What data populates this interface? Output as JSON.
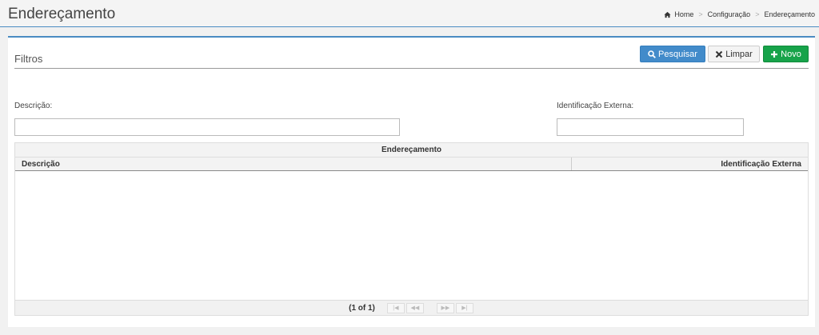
{
  "header": {
    "title": "Endereçamento",
    "breadcrumb": [
      "Home",
      "Configuração",
      "Endereçamento"
    ]
  },
  "filters": {
    "title": "Filtros",
    "buttons": {
      "search": "Pesquisar",
      "clear": "Limpar",
      "new": "Novo"
    },
    "fields": {
      "description": {
        "label": "Descrição:",
        "value": ""
      },
      "external_id": {
        "label": "Identificação Externa:",
        "value": ""
      }
    }
  },
  "grid": {
    "caption": "Endereçamento",
    "columns": [
      "Descrição",
      "Identificação Externa"
    ],
    "rows": [],
    "paginator": {
      "report": "(1 of 1)",
      "first": "|◀",
      "prev": "◀◀",
      "next": "▶▶",
      "last": "▶|"
    }
  },
  "colors": {
    "primary": "#428bca",
    "success": "#17a34a",
    "accent_line": "#4a8bc2"
  },
  "icons": {
    "home": "home-icon",
    "search": "search-icon",
    "clear": "close-icon",
    "new": "plus-icon"
  }
}
